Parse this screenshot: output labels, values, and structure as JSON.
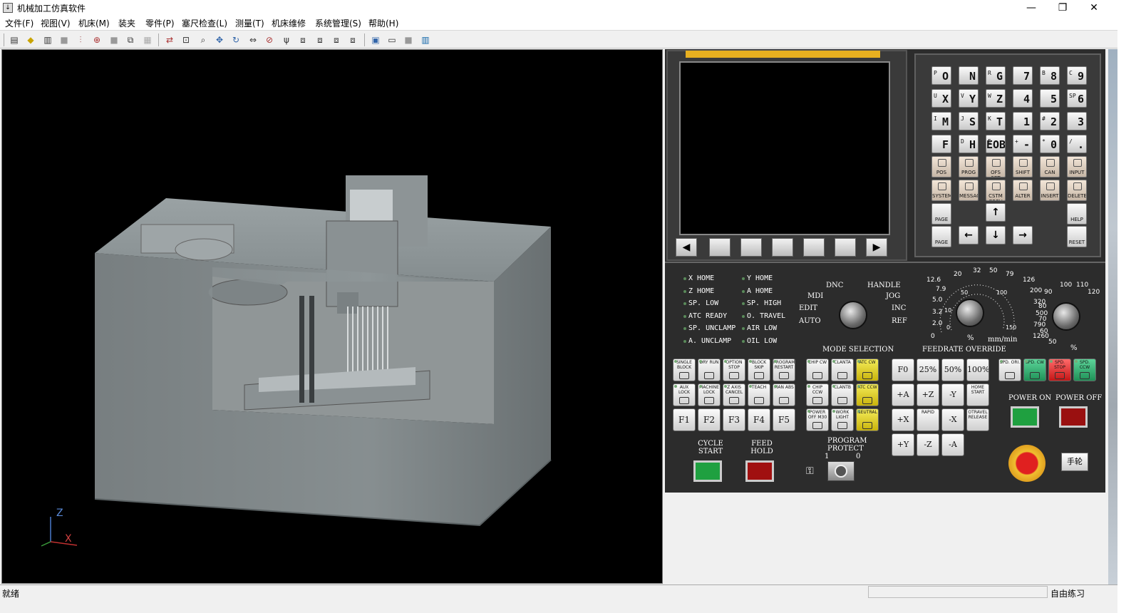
{
  "window": {
    "title": "机械加工仿真软件",
    "icon": "app-icon",
    "controls": [
      "minimize-icon",
      "restore-icon",
      "close-icon"
    ]
  },
  "menu": [
    "文件(F)",
    "视图(V)",
    "机床(M)",
    "装夹",
    "零件(P)",
    "塞尺检查(L)",
    "测量(T)",
    "机床维修",
    "系统管理(S)",
    "帮助(H)"
  ],
  "toolbar_icons": [
    "machine-icon",
    "stock-icon",
    "fixture-icon",
    "blank-icon",
    "tool-icon",
    "origin-icon",
    "blank-icon",
    "clamp-icon",
    "blank-icon",
    "reset-view-icon",
    "zoom-window-icon",
    "zoom-icon",
    "pan-icon",
    "rotate-icon",
    "flip-icon",
    "section-icon",
    "axis-icon",
    "front-view-icon",
    "top-view-icon",
    "side-view-icon",
    "left-view-icon",
    "panel-icon",
    "layout-icon",
    "blank-icon",
    "info-icon"
  ],
  "viewport": {
    "axis_labels": {
      "z": "Z",
      "x": "X"
    }
  },
  "cnc": {
    "address_keys": [
      {
        "sub": "P",
        "main": "O"
      },
      {
        "sub": "",
        "main": "N"
      },
      {
        "sub": "R",
        "main": "G"
      },
      {
        "sub": "",
        "main": "7"
      },
      {
        "sub": "B",
        "main": "8"
      },
      {
        "sub": "C",
        "main": "9"
      },
      {
        "sub": "U",
        "main": "X"
      },
      {
        "sub": "V",
        "main": "Y"
      },
      {
        "sub": "W",
        "main": "Z"
      },
      {
        "sub": "",
        "main": "4"
      },
      {
        "sub": "",
        "main": "5"
      },
      {
        "sub": "SP",
        "main": "6"
      },
      {
        "sub": "I",
        "main": "M"
      },
      {
        "sub": "J",
        "main": "S"
      },
      {
        "sub": "K",
        "main": "T"
      },
      {
        "sub": "",
        "main": "1"
      },
      {
        "sub": "#",
        "main": "2"
      },
      {
        "sub": "",
        "main": "3"
      },
      {
        "sub": "",
        "main": "F"
      },
      {
        "sub": "D",
        "main": "H"
      },
      {
        "sub": "E",
        "main": "EOB"
      },
      {
        "sub": "+",
        "main": "-"
      },
      {
        "sub": "*",
        "main": "0"
      },
      {
        "sub": "/",
        "main": "."
      }
    ],
    "function_keys": [
      "POS",
      "PROG",
      "OFS SET",
      "SHIFT",
      "CAN",
      "INPUT",
      "SYSTEM",
      "MESSAGE",
      "CSTM GRPH",
      "ALTER",
      "INSERT",
      "DELETE"
    ],
    "page_up": "PAGE",
    "page_down": "PAGE",
    "help": "HELP",
    "reset": "RESET",
    "arrows": {
      "up": "↑",
      "down": "↓",
      "left": "←",
      "right": "→"
    },
    "softkey_left": "◀",
    "softkey_right": "▶",
    "leds": [
      "X  HOME",
      "Y  HOME",
      "Z  HOME",
      "A  HOME",
      "SP. LOW",
      "SP. HIGH",
      "ATC  READY",
      "O. TRAVEL",
      "SP. UNCLAMP",
      "AIR  LOW",
      "A. UNCLAMP",
      "OIL  LOW"
    ],
    "mode": {
      "title": "MODE SELECTION",
      "left": [
        "MDI",
        "EDIT",
        "AUTO"
      ],
      "right": [
        "HANDLE",
        "JOG",
        "INC",
        "REF"
      ],
      "top": "DNC"
    },
    "feedrate": {
      "title": "FEEDRATE OVERRIDE",
      "unit": "mm/min",
      "pct": "%",
      "scale": [
        "0",
        "2.0",
        "3.2",
        "5.0",
        "7.9",
        "12.6",
        "20",
        "32",
        "50",
        "79",
        "126",
        "200",
        "320",
        "500",
        "790",
        "1260"
      ],
      "inner": [
        "0",
        "10",
        "50",
        "100",
        "150"
      ]
    },
    "spindle": {
      "scale": [
        "50",
        "60",
        "70",
        "80",
        "90",
        "100",
        "110",
        "120"
      ],
      "pct": "%"
    },
    "op_buttons": [
      "SINGLE BLOCK",
      "DRY RUN",
      "OPTION STOP",
      "BLOCK SKIP",
      "PROGRAM RESTART",
      "AUX LOCK",
      "MACHINE LOCK",
      "Z AXIS CANCEL",
      "TEACH",
      "MAN ABS"
    ],
    "fkeys": [
      "F1",
      "F2",
      "F3",
      "F4",
      "F5"
    ],
    "chip_buttons": [
      "CHIP CW",
      "CLANTA",
      "ATC CW",
      "CHIP CCW",
      "CLANTB",
      "ATC CCW",
      "POWER OFF M30",
      "WORK LIGHT",
      "NEUTRAL"
    ],
    "rapid": [
      "F0",
      "25%",
      "50%",
      "100%"
    ],
    "jog": [
      "+A",
      "+Z",
      "-Y",
      "HOME START",
      "+X",
      "RAPID",
      "-X",
      "OTRAVEL RELEASE",
      "+Y",
      "-Z",
      "-A"
    ],
    "spindle_btns": [
      "SPD. ORI.",
      "SPD. CW",
      "SPD. STOP",
      "SPD. CCW"
    ],
    "power_on": "POWER ON",
    "power_off": "POWER OFF",
    "cycle_start": "CYCLE START",
    "feed_hold": "FEED HOLD",
    "program_protect": "PROGRAM PROTECT",
    "protect_1": "1",
    "protect_0": "0",
    "handwheel": "手轮"
  },
  "status": {
    "left": "就绪",
    "right": "自由练习"
  }
}
